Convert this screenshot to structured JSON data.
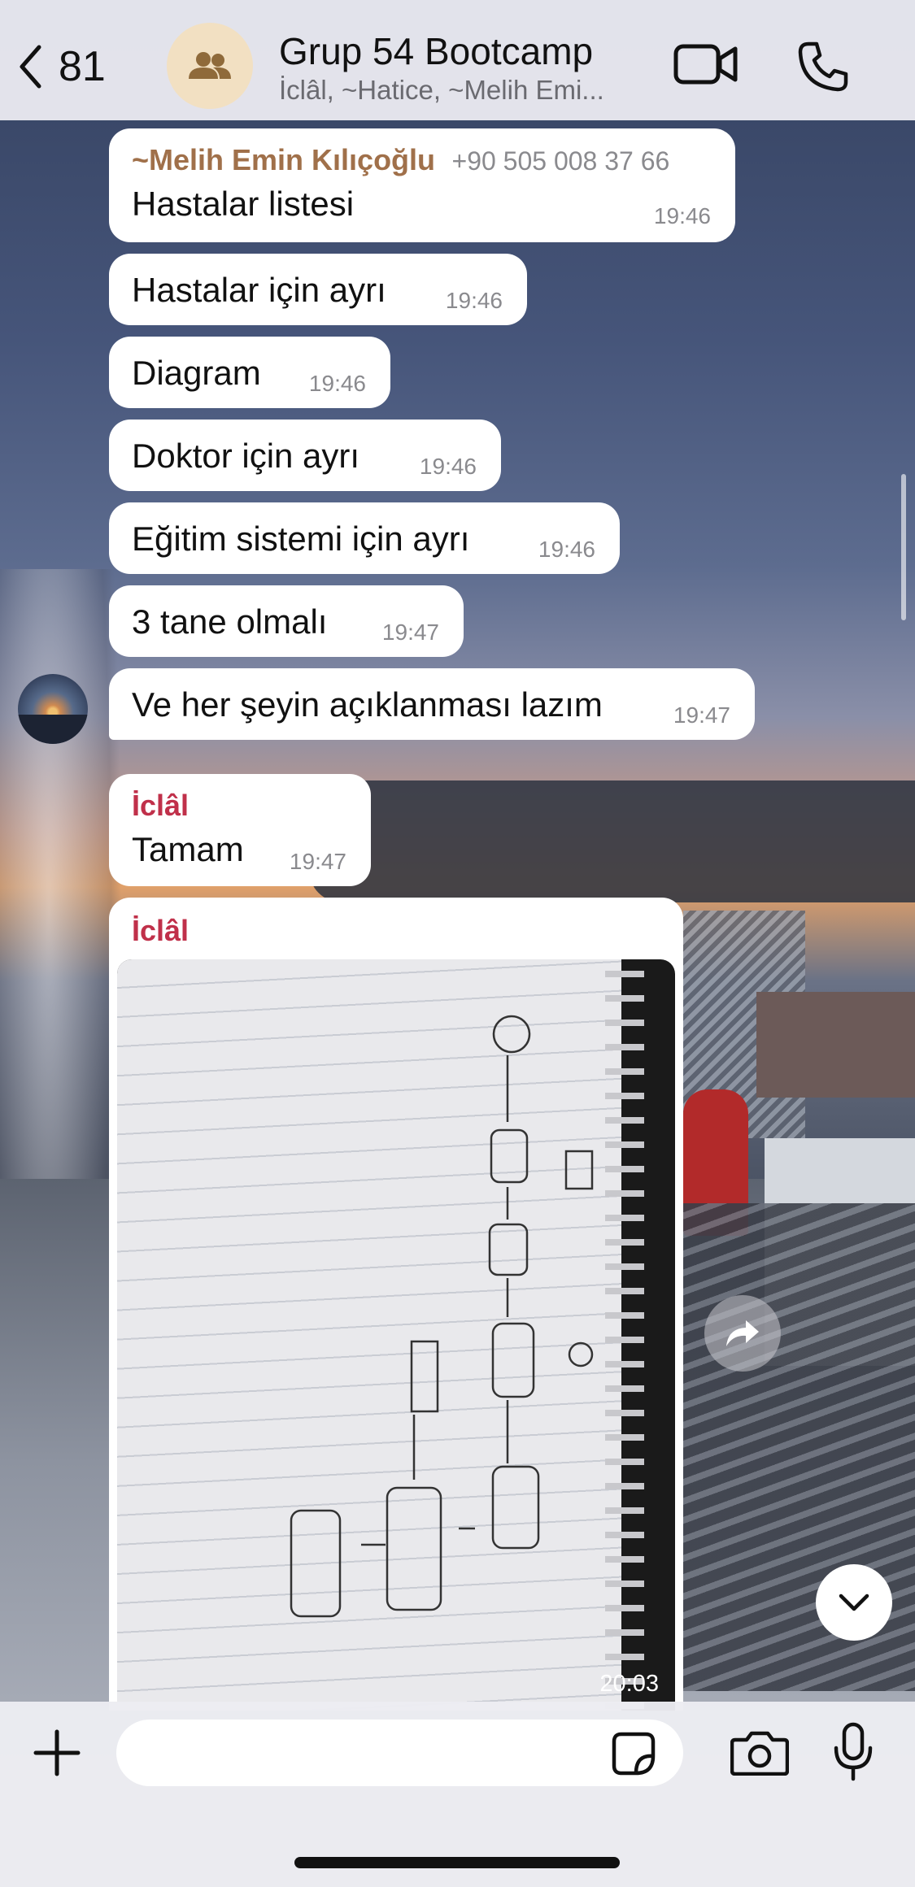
{
  "header": {
    "back_count": "81",
    "title": "Grup 54 Bootcamp",
    "subtitle": "İclâl, ~Hatice, ~Melih Emi..."
  },
  "messages": [
    {
      "sender": "~Melih Emin Kılıçoğlu",
      "sender_phone": "+90 505 008 37 66",
      "text": "Hastalar listesi",
      "time": "19:46"
    },
    {
      "text": "Hastalar için ayrı",
      "time": "19:46"
    },
    {
      "text": "Diagram",
      "time": "19:46"
    },
    {
      "text": "Doktor için ayrı",
      "time": "19:46"
    },
    {
      "text": "Eğitim sistemi için ayrı",
      "time": "19:46"
    },
    {
      "text": "3 tane olmalı",
      "time": "19:47"
    },
    {
      "text": "Ve her şeyin açıklanması lazım",
      "time": "19:47"
    },
    {
      "sender": "İclâl",
      "text": "Tamam",
      "time": "19:47"
    },
    {
      "sender": "İclâl",
      "image": "handwritten-flow-diagram-notebook",
      "time": "20:03"
    }
  ],
  "colors": {
    "sender_melih": "#a0704a",
    "sender_iclal": "#c0304a",
    "bubble_bg": "#ffffff",
    "header_bg": "#ececf2"
  },
  "composer": {
    "placeholder": ""
  },
  "icons": [
    "chevron-left-icon",
    "group-icon",
    "video-camera-icon",
    "phone-icon",
    "forward-icon",
    "chevron-down-icon",
    "plus-icon",
    "sticker-icon",
    "camera-icon",
    "microphone-icon"
  ]
}
